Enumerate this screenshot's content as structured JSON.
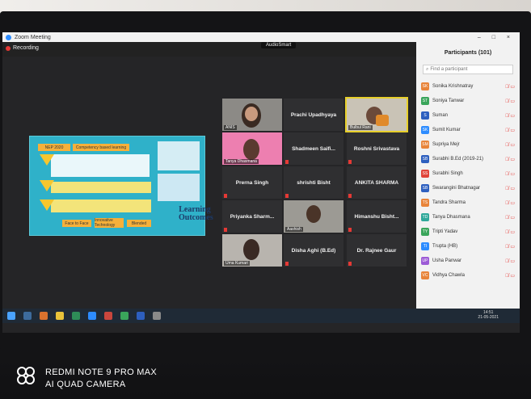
{
  "window": {
    "title": "Zoom Meeting"
  },
  "topbar": {
    "recording": "Recording",
    "center_badge": "AudioSmart"
  },
  "slide": {
    "header": [
      "NEP 2020",
      "Competency based learning"
    ],
    "learning_outcomes": "Learning Outcomes",
    "buttons": [
      "Face to Face",
      "Innovative Technology",
      "Blended"
    ]
  },
  "gallery": [
    {
      "label": "Prachi Upadhyaya",
      "video": false
    },
    {
      "label": "Shadmeen Saifi...",
      "video": false
    },
    {
      "label": "Roshni Srivastava",
      "video": false
    },
    {
      "label": "Prerna Singh",
      "video": false
    },
    {
      "label": "shrishti Bisht",
      "video": false
    },
    {
      "label": "ANKITA SHARMA",
      "video": false
    },
    {
      "label": "Priyanka Sharm...",
      "video": false
    },
    {
      "label": "Himanshu Bisht...",
      "video": false
    },
    {
      "label": "Disha Aghi (B.Ed)",
      "video": false
    },
    {
      "label": "Dr. Rajnee Gaur",
      "video": false
    }
  ],
  "video_tags": {
    "t1": "ANIS",
    "t2": "Bulbul Rani",
    "t3": "Tanya Dhasmana",
    "t4": "Aashish",
    "t5": "Uma Kumari"
  },
  "participants": {
    "title": "Participants (101)",
    "search_placeholder": "Find a participant",
    "list": [
      {
        "initials": "SK",
        "name": "Sonika Krishnatray",
        "color": "#e8843a"
      },
      {
        "initials": "ST",
        "name": "Soniya Tanwar",
        "color": "#3aa55b"
      },
      {
        "initials": "S",
        "name": "Suman",
        "color": "#2d5fbf"
      },
      {
        "initials": "SK",
        "name": "Sumit Kumar",
        "color": "#2d8cff"
      },
      {
        "initials": "SM",
        "name": "Supriya Mejr",
        "color": "#e8843a"
      },
      {
        "initials": "SB",
        "name": "Surabhi B.Ed (2019-21)",
        "color": "#2d5fbf"
      },
      {
        "initials": "SS",
        "name": "Surabhi Singh",
        "color": "#e0443a"
      },
      {
        "initials": "SB",
        "name": "Swarangini Bhatnagar",
        "color": "#2d5fbf"
      },
      {
        "initials": "TS",
        "name": "Tandra Sharma",
        "color": "#e8843a"
      },
      {
        "initials": "TD",
        "name": "Tanya Dhasmana",
        "color": "#2fa89a"
      },
      {
        "initials": "TY",
        "name": "Tripti Yadav",
        "color": "#3aa55b"
      },
      {
        "initials": "TI",
        "name": "Trupta (HB)",
        "color": "#2d8cff"
      },
      {
        "initials": "UP",
        "name": "Usha Panwar",
        "color": "#9c5bd6"
      },
      {
        "initials": "VC",
        "name": "Vidhya Chawla",
        "color": "#e8843a"
      }
    ]
  },
  "taskbar": {
    "time": "14:51",
    "date": "21-05-2021"
  },
  "watermark": {
    "line1": "REDMI NOTE 9 PRO MAX",
    "line2": "AI QUAD CAMERA"
  }
}
